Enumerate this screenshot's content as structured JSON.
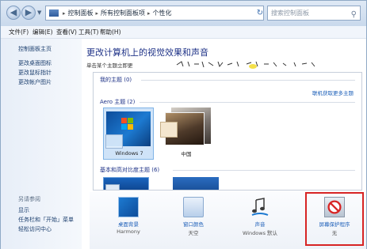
{
  "address_bar": {
    "path": [
      "控制面板",
      "所有控制面板项",
      "个性化"
    ],
    "search_placeholder": "搜索控制面板"
  },
  "menu": [
    "文件(F)",
    "编辑(E)",
    "查看(V)",
    "工具(T)",
    "帮助(H)"
  ],
  "left_pane": {
    "links": [
      "控制面板主页",
      "更改桌面图标",
      "更改鼠标指针",
      "更改帐户图片"
    ],
    "see_also_title": "另请参阅",
    "see_also_links": [
      "显示",
      "任务栏和「开始」菜单",
      "轻松访问中心"
    ]
  },
  "main": {
    "title": "更改计算机上的视觉效果和声音",
    "description": "单击某个主题立即更",
    "theme_groups": {
      "my_themes": "我的主题 (0)",
      "online_link": "联机获取更多主题",
      "aero": "Aero 主题 (2)",
      "basic": "基本和高对比度主题 (6)"
    },
    "themes": [
      {
        "label": "Windows 7",
        "selected": true
      },
      {
        "label": "中国",
        "selected": false
      }
    ]
  },
  "bottom_strip": {
    "items": [
      {
        "label": "桌面背景",
        "sub": "Harmony",
        "icon": "desktop-background-icon"
      },
      {
        "label": "窗口颜色",
        "sub": "天空",
        "icon": "window-color-icon"
      },
      {
        "label": "声音",
        "sub": "Windows 默认",
        "icon": "sound-icon"
      },
      {
        "label": "屏幕保护程序",
        "sub": "无",
        "icon": "screen-saver-icon"
      }
    ]
  },
  "colors": {
    "title_blue": "#1e3287",
    "link_blue": "#1c5fb8",
    "highlight_red": "#d72424"
  }
}
